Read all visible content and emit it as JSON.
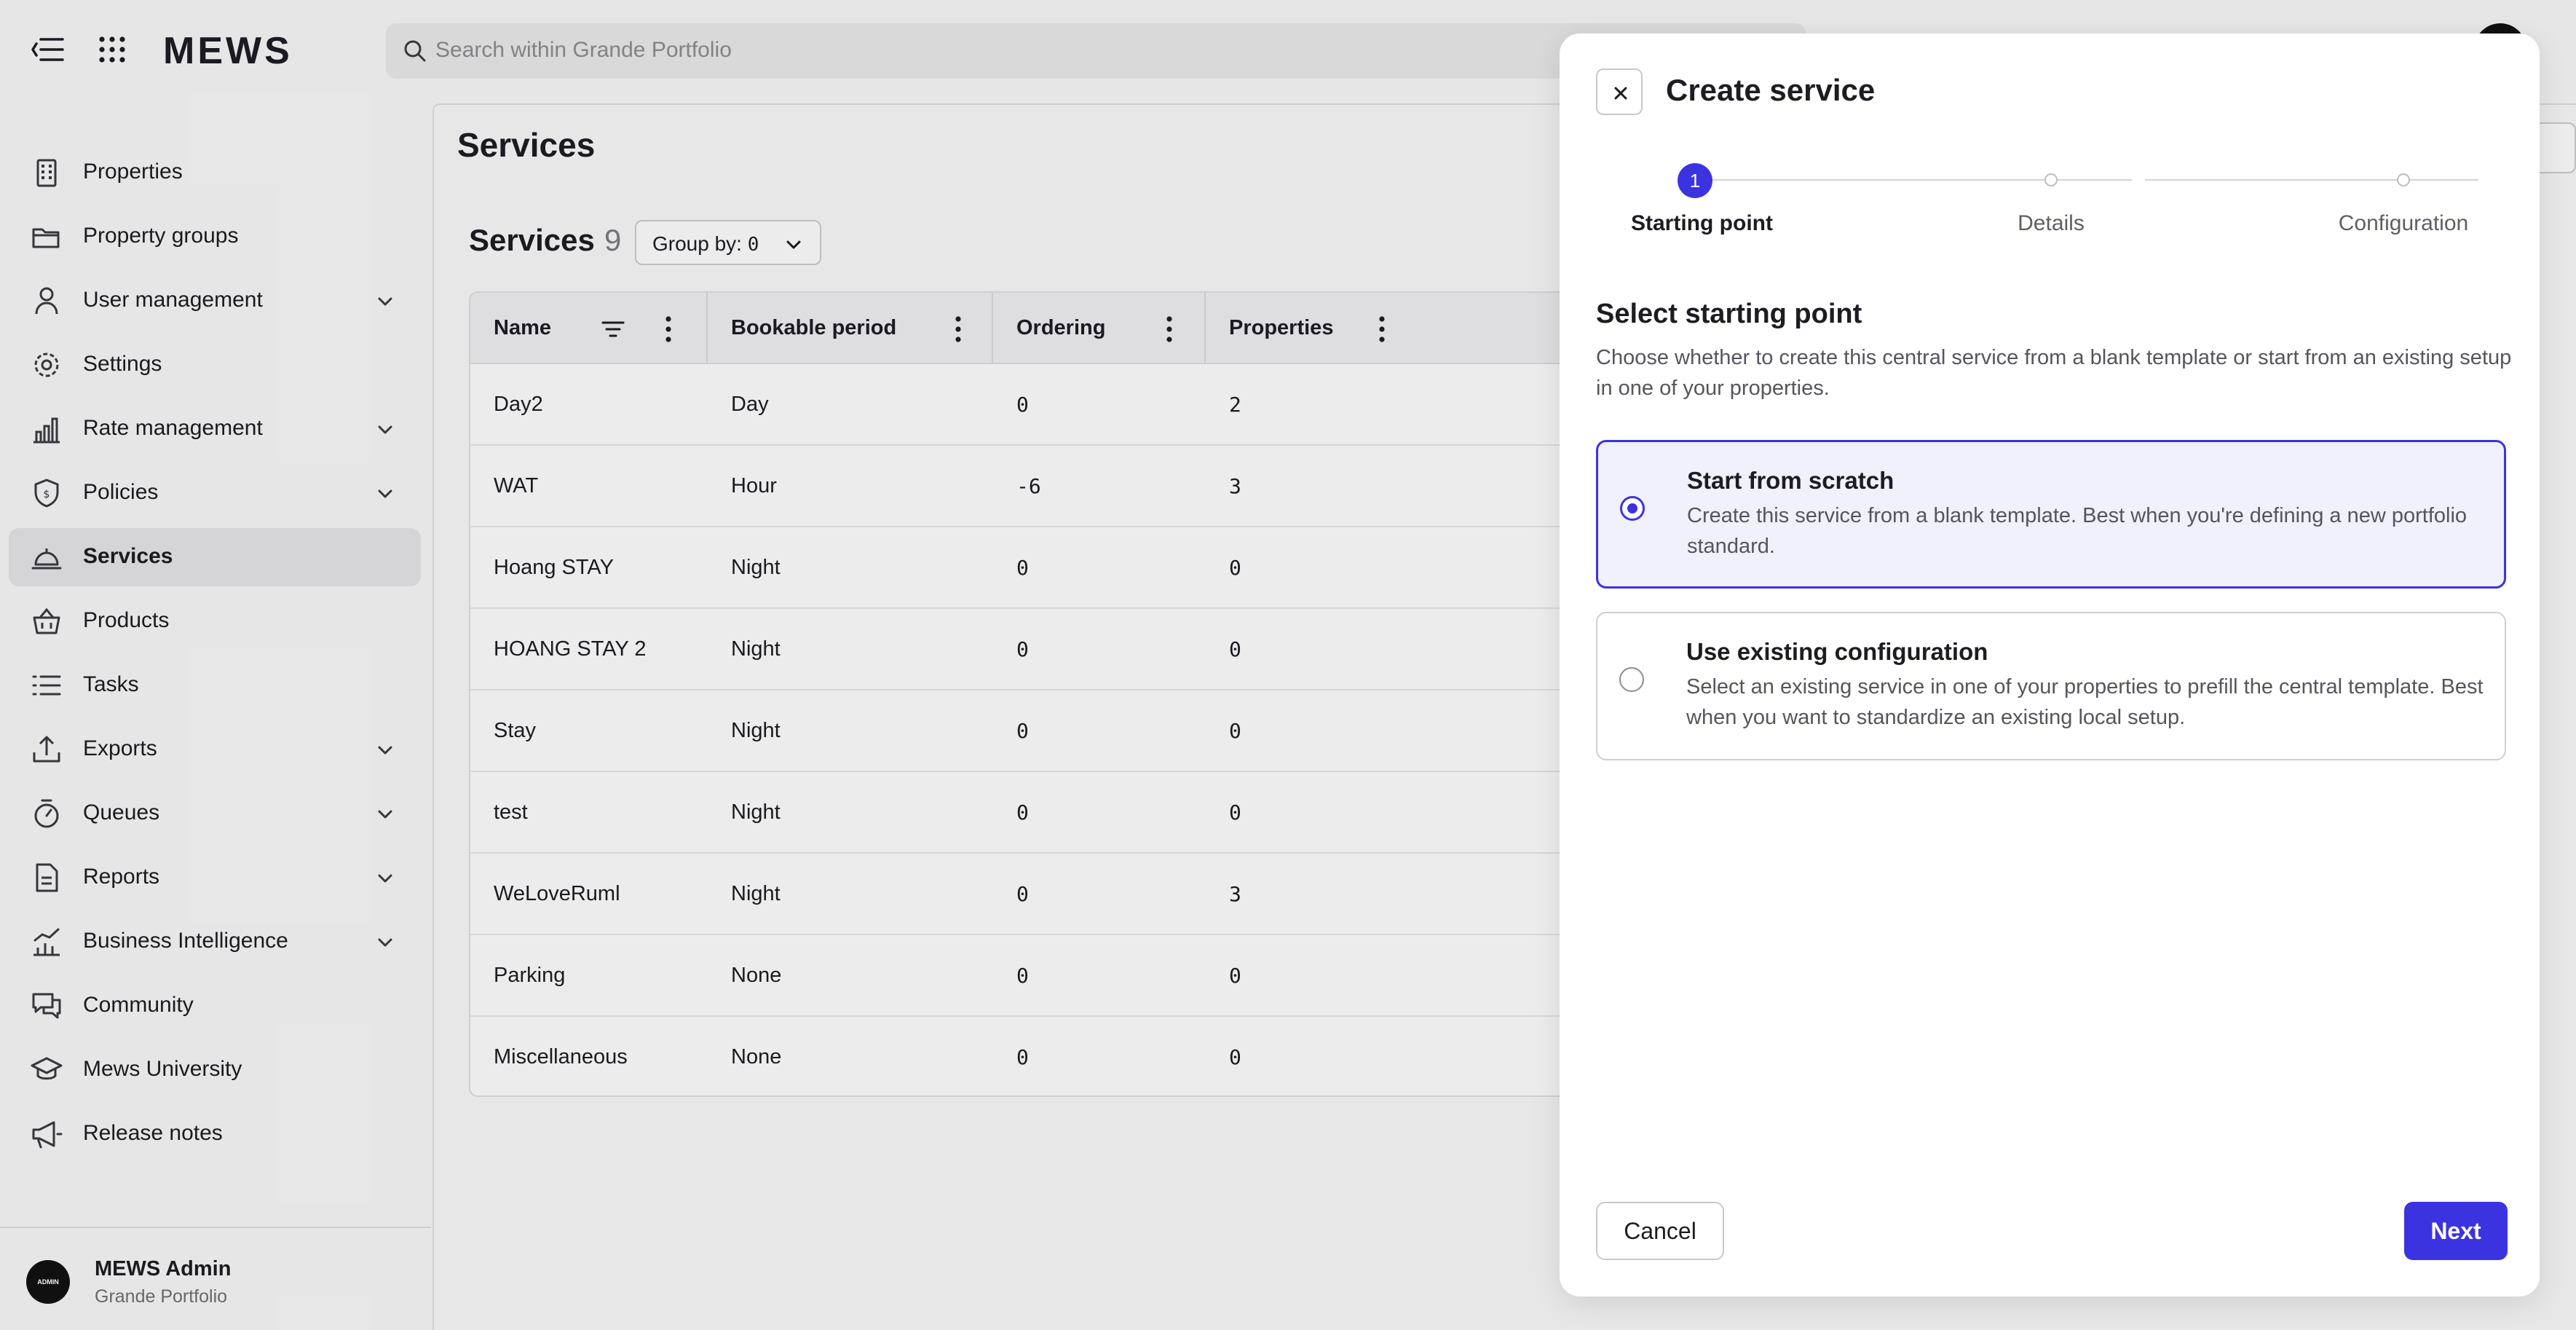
{
  "app": {
    "logo": "MEWS",
    "search_placeholder": "Search within Grande Portfolio"
  },
  "sidebar": {
    "items": [
      {
        "label": "Properties",
        "icon": "building-icon",
        "expandable": false,
        "active": false
      },
      {
        "label": "Property groups",
        "icon": "folder-icon",
        "expandable": false,
        "active": false
      },
      {
        "label": "User management",
        "icon": "user-icon",
        "expandable": true,
        "active": false
      },
      {
        "label": "Settings",
        "icon": "gear-icon",
        "expandable": false,
        "active": false
      },
      {
        "label": "Rate management",
        "icon": "bar-chart-icon",
        "expandable": true,
        "active": false
      },
      {
        "label": "Policies",
        "icon": "shield-icon",
        "expandable": true,
        "active": false
      },
      {
        "label": "Services",
        "icon": "bell-service-icon",
        "expandable": false,
        "active": true
      },
      {
        "label": "Products",
        "icon": "basket-icon",
        "expandable": false,
        "active": false
      },
      {
        "label": "Tasks",
        "icon": "list-icon",
        "expandable": false,
        "active": false
      },
      {
        "label": "Exports",
        "icon": "export-icon",
        "expandable": true,
        "active": false
      },
      {
        "label": "Queues",
        "icon": "stopwatch-icon",
        "expandable": true,
        "active": false
      },
      {
        "label": "Reports",
        "icon": "report-icon",
        "expandable": true,
        "active": false
      },
      {
        "label": "Business Intelligence",
        "icon": "trend-chart-icon",
        "expandable": true,
        "active": false
      },
      {
        "label": "Community",
        "icon": "chat-icon",
        "expandable": false,
        "active": false
      },
      {
        "label": "Mews University",
        "icon": "graduation-cap-icon",
        "expandable": false,
        "active": false
      },
      {
        "label": "Release notes",
        "icon": "megaphone-icon",
        "expandable": false,
        "active": false
      }
    ],
    "user": {
      "avatar_text": "ADMIN",
      "name": "MEWS Admin",
      "org": "Grande Portfolio"
    }
  },
  "main": {
    "page_title": "Services",
    "section_title": "Services",
    "section_count": "9",
    "group_by_label": "Group by:",
    "group_by_value": "0",
    "columns": [
      "Name",
      "Bookable period",
      "Ordering",
      "Properties"
    ],
    "rows": [
      {
        "name": "Day2",
        "period": "Day",
        "ordering": "0",
        "properties": "2"
      },
      {
        "name": "WAT",
        "period": "Hour",
        "ordering": "-6",
        "properties": "3"
      },
      {
        "name": "Hoang STAY",
        "period": "Night",
        "ordering": "0",
        "properties": "0"
      },
      {
        "name": "HOANG STAY 2",
        "period": "Night",
        "ordering": "0",
        "properties": "0"
      },
      {
        "name": "Stay",
        "period": "Night",
        "ordering": "0",
        "properties": "0"
      },
      {
        "name": "test",
        "period": "Night",
        "ordering": "0",
        "properties": "0"
      },
      {
        "name": "WeLoveRuml",
        "period": "Night",
        "ordering": "0",
        "properties": "3"
      },
      {
        "name": "Parking",
        "period": "None",
        "ordering": "0",
        "properties": "0"
      },
      {
        "name": "Miscellaneous",
        "period": "None",
        "ordering": "0",
        "properties": "0"
      }
    ]
  },
  "panel": {
    "title": "Create service",
    "steps": [
      {
        "number": "1",
        "label": "Starting point",
        "active": true
      },
      {
        "number": "",
        "label": "Details",
        "active": false
      },
      {
        "number": "",
        "label": "Configuration",
        "active": false
      }
    ],
    "subtitle": "Select starting point",
    "description": "Choose whether to create this central service from a blank template or start from an existing setup in one of your properties.",
    "options": [
      {
        "title": "Start from scratch",
        "description": "Create this service from a blank template. Best when you're defining a new portfolio standard.",
        "selected": true
      },
      {
        "title": "Use existing configuration",
        "description": "Select an existing service in one of your properties to prefill the central template. Best when you want to standardize an existing local setup.",
        "selected": false
      }
    ],
    "cancel_label": "Cancel",
    "next_label": "Next"
  },
  "colors": {
    "accent": "#3c33e0",
    "selected_bg": "#f1f0fd",
    "text_primary": "#1c1c22",
    "text_secondary": "#55555d"
  }
}
